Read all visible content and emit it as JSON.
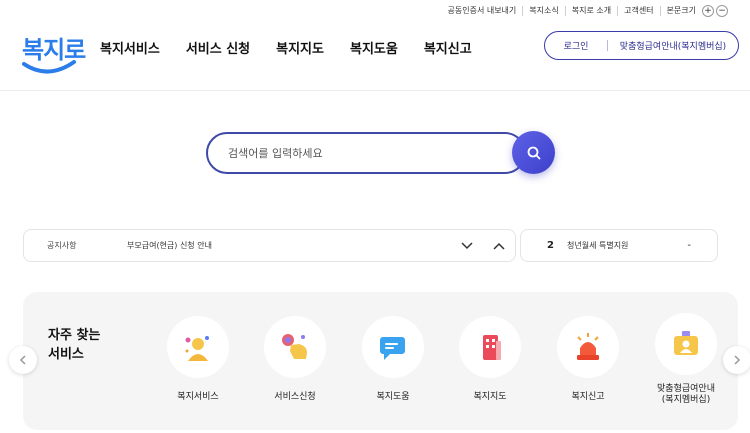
{
  "util_bar": {
    "items": [
      "공동인증서 내보내기",
      "복지소식",
      "복지로 소개",
      "고객센터"
    ],
    "zoom_label": "본문크기",
    "zoom_in": "+",
    "zoom_out": "−"
  },
  "logo": {
    "text": "복지로"
  },
  "nav": {
    "items": [
      "복지서비스",
      "서비스 신청",
      "복지지도",
      "복지도움",
      "복지신고"
    ]
  },
  "member": {
    "login": "로그인",
    "guide": "맞춤형급여안내(복지멤버십)"
  },
  "search": {
    "placeholder": "검색어를 입력하세요"
  },
  "notice": {
    "category": "공지사항",
    "text": "부모급여(현금) 신청 안내"
  },
  "notice2": {
    "number": "2",
    "text": "청년월세 특별지원",
    "dash": "-"
  },
  "freq": {
    "title_line1": "자주 찾는",
    "title_line2": "서비스",
    "items": [
      {
        "label": "복지서비스",
        "icon": "person-icon"
      },
      {
        "label": "서비스신청",
        "icon": "hand-click-icon"
      },
      {
        "label": "복지도움",
        "icon": "chat-icon"
      },
      {
        "label": "복지지도",
        "icon": "building-icon"
      },
      {
        "label": "복지신고",
        "icon": "alarm-icon"
      },
      {
        "label": "맞춤형급여안내",
        "label2": "(복지멤버십)",
        "icon": "membership-card-icon"
      }
    ]
  },
  "colors": {
    "brand_blue": "#2b7de9",
    "nav_indigo": "#3f4aa6",
    "search_button": "#4b4ed8"
  }
}
